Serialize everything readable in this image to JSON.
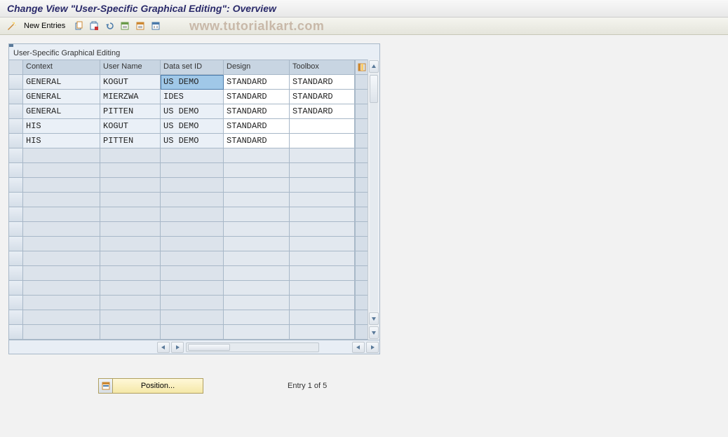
{
  "title": "Change View \"User-Specific Graphical Editing\": Overview",
  "toolbar": {
    "new_entries": "New Entries"
  },
  "watermark": "www.tutorialkart.com",
  "panel": {
    "label": "User-Specific Graphical Editing"
  },
  "columns": {
    "context": "Context",
    "user": "User Name",
    "dataset": "Data set ID",
    "design": "Design",
    "toolbox": "Toolbox"
  },
  "rows": [
    {
      "context": "GENERAL",
      "user": "KOGUT",
      "dataset": "US DEMO",
      "design": "STANDARD",
      "toolbox": "STANDARD"
    },
    {
      "context": "GENERAL",
      "user": "MIERZWA",
      "dataset": "IDES",
      "design": "STANDARD",
      "toolbox": "STANDARD"
    },
    {
      "context": "GENERAL",
      "user": "PITTEN",
      "dataset": "US DEMO",
      "design": "STANDARD",
      "toolbox": "STANDARD"
    },
    {
      "context": "HIS",
      "user": "KOGUT",
      "dataset": "US DEMO",
      "design": "STANDARD",
      "toolbox": ""
    },
    {
      "context": "HIS",
      "user": "PITTEN",
      "dataset": "US DEMO",
      "design": "STANDARD",
      "toolbox": ""
    }
  ],
  "empty_rows": 13,
  "position_button": "Position...",
  "entry_status": "Entry 1 of 5"
}
